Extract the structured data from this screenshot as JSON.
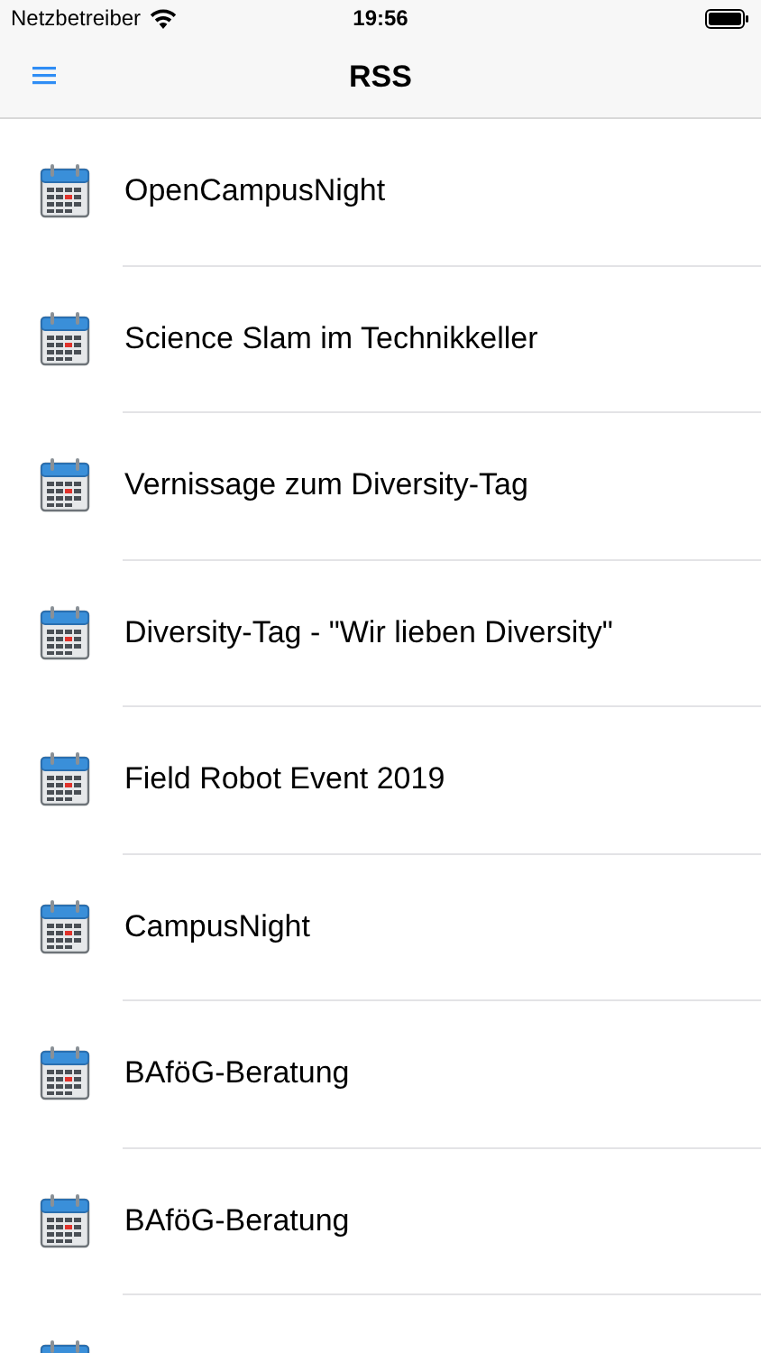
{
  "status_bar": {
    "carrier": "Netzbetreiber",
    "time": "19:56"
  },
  "nav_bar": {
    "title": "RSS"
  },
  "items": [
    {
      "kind": "event",
      "title": "OpenCampusNight"
    },
    {
      "kind": "event",
      "title": "Science Slam im Technikkeller"
    },
    {
      "kind": "event",
      "title": "Vernissage zum Diversity-Tag"
    },
    {
      "kind": "event",
      "title": "Diversity-Tag - \"Wir lieben Diversity\""
    },
    {
      "kind": "event",
      "title": "Field Robot Event 2019"
    },
    {
      "kind": "event",
      "title": "CampusNight"
    },
    {
      "kind": "event",
      "title": "BAföG-Beratung"
    },
    {
      "kind": "event",
      "title": "BAföG-Beratung"
    },
    {
      "kind": "cut-off"
    }
  ]
}
